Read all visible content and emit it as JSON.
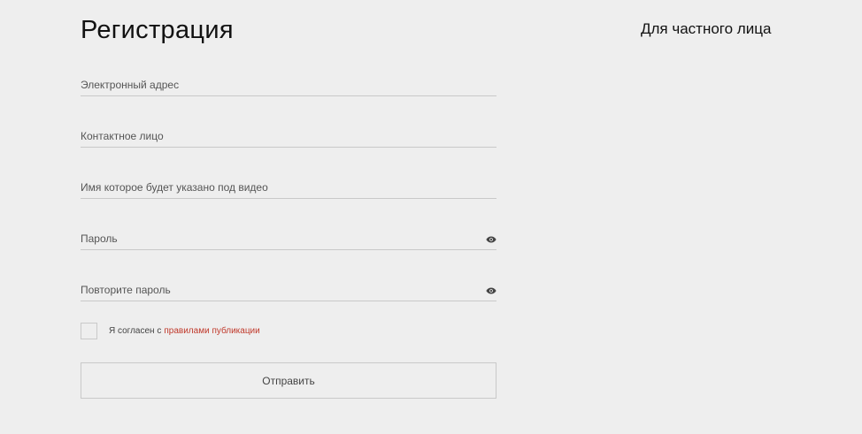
{
  "header": {
    "title": "Регистрация",
    "account_type": "Для частного лица"
  },
  "form": {
    "email": {
      "placeholder": "Электронный адрес",
      "value": ""
    },
    "contact": {
      "placeholder": "Контактное лицо",
      "value": ""
    },
    "display_name": {
      "placeholder": "Имя которое будет указано под видео",
      "value": ""
    },
    "password": {
      "placeholder": "Пароль",
      "value": "",
      "icon": "eye-icon"
    },
    "password_repeat": {
      "placeholder": "Повторите пароль",
      "value": "",
      "icon": "eye-icon"
    },
    "consent": {
      "checked": false,
      "text": "Я согласен с",
      "link_text": "правилами публикации"
    },
    "submit_label": "Отправить"
  },
  "colors": {
    "background": "#eeeeee",
    "link": "#c0392b",
    "border": "#c9c9c9"
  }
}
